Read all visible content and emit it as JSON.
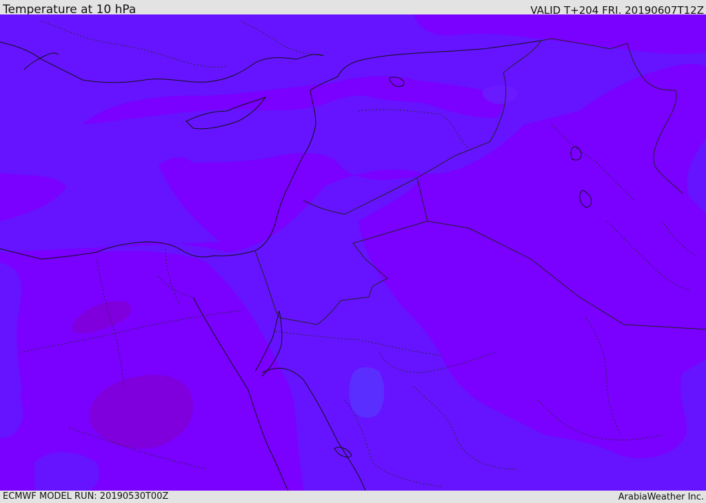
{
  "header": {
    "title": "Temperature at 10 hPa",
    "valid": "VALID T+204 FRI. 20190607T12Z"
  },
  "footer": {
    "model_run": "ECMWF MODEL RUN: 20190530T00Z",
    "credit": "ArabiaWeather Inc."
  },
  "map": {
    "colors": {
      "warm_band": "#7a00ff",
      "cool_band": "#6613ff",
      "warmest_patch": "#7f00dd",
      "coolest_patch": "#5a2eff",
      "coastline": "#111111",
      "border": "#222222"
    }
  }
}
